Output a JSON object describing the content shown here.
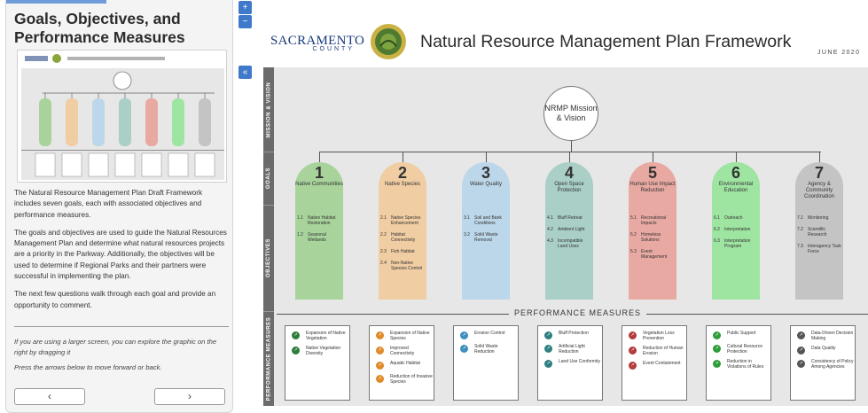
{
  "panel": {
    "title": "Goals, Objectives, and Performance Measures",
    "paragraphs": [
      "The Natural Resource Management Plan Draft Framework includes seven goals, each with associated objectives and performance measures.",
      "The goals and objectives are used to guide the Natural Resources Management Plan and determine what natural resources projects are a priority in the Parkway. Additionally, the objectives will be used to determine if Regional Parks and their partners were successful in implementing the plan.",
      "The next few questions walk through each goal and provide an opportunity to comment."
    ],
    "hints": [
      "If you are using a larger screen, you can explore the graphic on the right by dragging it",
      "Press the arrows below to move forward or back."
    ],
    "prev_label": "‹",
    "next_label": "›"
  },
  "controls": {
    "zoom_in": "+",
    "zoom_out": "−",
    "collapse": "«"
  },
  "header": {
    "logo_word": "SACRAMENTO",
    "logo_sub": "COUNTY",
    "title": "Natural Resource Management Plan Framework",
    "date": "JUNE 2020"
  },
  "rows": [
    "MISSION & VISION",
    "GOALS",
    "OBJECTIVES",
    "PERFORMANCE MEASURES"
  ],
  "mission": "NRMP Mission & Vision",
  "performance_label": "PERFORMANCE MEASURES",
  "goals": [
    {
      "num": "1",
      "name": "Native Communities",
      "color": "#a8d49c",
      "icon": "#2f7d3a",
      "objectives": [
        [
          "1.1",
          "Native Habitat Restoration"
        ],
        [
          "1.2",
          "Seasonal Wetlands"
        ]
      ],
      "measures": [
        "Expansion of Native Vegetation",
        "Native Vegetation Diversity"
      ]
    },
    {
      "num": "2",
      "name": "Native Species",
      "color": "#f0cda3",
      "icon": "#e08a2a",
      "objectives": [
        [
          "2.1",
          "Native Species Enhancement"
        ],
        [
          "2.2",
          "Habitat Connectivity"
        ],
        [
          "2.3",
          "Fish Habitat"
        ],
        [
          "2.4",
          "Non-Native Species Control"
        ]
      ],
      "measures": [
        "Expansion of Native Species",
        "Improved Connectivity",
        "Aquatic Habitat",
        "Reduction of Invasive Species"
      ]
    },
    {
      "num": "3",
      "name": "Water Quality",
      "color": "#bcd7e9",
      "icon": "#3c8fbf",
      "objectives": [
        [
          "3.1",
          "Soil and Bank Conditions"
        ],
        [
          "3.2",
          "Solid Waste Removal"
        ]
      ],
      "measures": [
        "Erosion Control",
        "Solid Waste Reduction"
      ]
    },
    {
      "num": "4",
      "name": "Open Space Protection",
      "color": "#a9cfc7",
      "icon": "#2e7f80",
      "objectives": [
        [
          "4.1",
          "Bluff Retreat"
        ],
        [
          "4.2",
          "Ambient Light"
        ],
        [
          "4.3",
          "Incompatible Land Uses"
        ]
      ],
      "measures": [
        "Bluff Protection",
        "Artificial Light Reduction",
        "Land Use Conformity"
      ]
    },
    {
      "num": "5",
      "name": "Human Use Impact Reduction",
      "color": "#e8a9a2",
      "icon": "#b53a3a",
      "objectives": [
        [
          "5.1",
          "Recreational Impacts"
        ],
        [
          "5.2",
          "Homeless Solutions"
        ],
        [
          "5.3",
          "Event Management"
        ]
      ],
      "measures": [
        "Vegetation Loss Prevention",
        "Reduction of Human Erosion",
        "Event Containment"
      ]
    },
    {
      "num": "6",
      "name": "Environmental Education",
      "color": "#9fe5a2",
      "icon": "#2e9e3a",
      "objectives": [
        [
          "6.1",
          "Outreach"
        ],
        [
          "6.2",
          "Interpretation"
        ],
        [
          "6.3",
          "Interpretation Program"
        ]
      ],
      "measures": [
        "Public Support",
        "Cultural Resource Protection",
        "Reduction in Violations of Rules"
      ]
    },
    {
      "num": "7",
      "name": "Agency & Community Coordination",
      "color": "#c4c4c4",
      "icon": "#555555",
      "objectives": [
        [
          "7.1",
          "Monitoring"
        ],
        [
          "7.2",
          "Scientific Research"
        ],
        [
          "7.3",
          "Interagency Task Force"
        ]
      ],
      "measures": [
        "Data-Driven Decision Making",
        "Data Quality",
        "Consistency of Policy Among Agencies"
      ]
    }
  ]
}
